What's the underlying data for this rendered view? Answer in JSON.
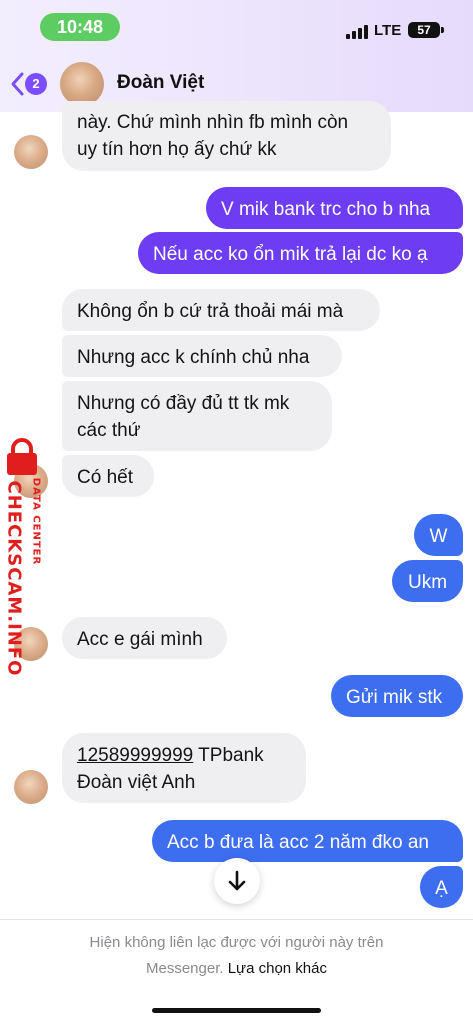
{
  "status_bar": {
    "time": "10:48",
    "network": "LTE",
    "battery": "57"
  },
  "header": {
    "back_badge": "2",
    "contact_name": "Đoàn Việt"
  },
  "messages": {
    "m1": "này.  Chứ mình nhìn fb mình còn\nuy tín hơn họ ấy chứ kk",
    "m2": "V mik bank trc cho b nha",
    "m3": "Nếu acc ko ổn mik trả lại dc ko ạ",
    "m4": "Không ổn b cứ trả thoải mái mà",
    "m5": "Nhưng acc k chính chủ nha",
    "m6": "Nhưng có đầy đủ tt tk mk\ncác thứ",
    "m7": "Có hết",
    "m8": "W",
    "m9": "Ukm",
    "m10": "Acc e gái mình",
    "m11": "Gửi mik stk",
    "m12_account": "12589999999",
    "m12_rest": " TPbank\nĐoàn việt Anh",
    "m13": "Acc b đưa là acc 2 năm đko an",
    "m14": "Ạ"
  },
  "footer": {
    "notice": "Hiện không liên lạc được với người này trên\nMessenger.",
    "link": "Lựa chọn khác"
  },
  "watermark": {
    "main": "CHECKSCAM.INFO",
    "sub": "DATA CENTER"
  },
  "colors": {
    "outgoing_purple": "#6d3cf3",
    "outgoing_blue": "#3d6ef0",
    "incoming": "#efeff1",
    "accent": "#7c4dff",
    "watermark": "#e01e1e"
  }
}
